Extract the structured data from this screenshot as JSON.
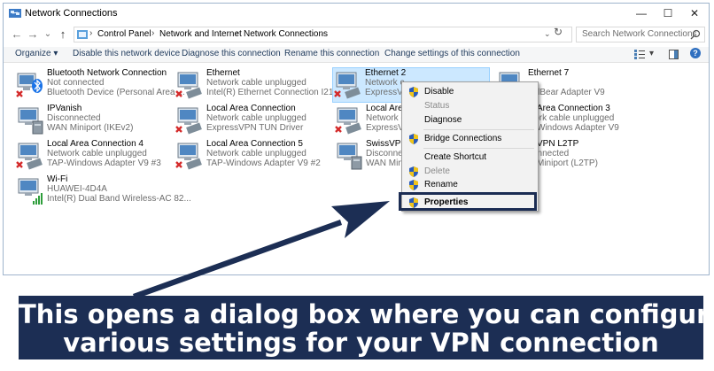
{
  "window": {
    "title": "Network Connections",
    "controls": {
      "minimize": "—",
      "maximize": "☐",
      "close": "✕"
    }
  },
  "address_bar": {
    "back_icon": "←",
    "forward_icon": "→",
    "recent_icon": "⌄",
    "up_icon": "↑",
    "breadcrumb": [
      "Control Panel",
      "Network and Internet",
      "Network Connections"
    ],
    "separator": "›",
    "dropdown_icon": "⌄",
    "refresh_icon": "↻",
    "search_placeholder": "Search Network Connections"
  },
  "toolbar": {
    "organize": "Organize ▾",
    "disable_device": "Disable this network device",
    "diagnose": "Diagnose this connection",
    "rename": "Rename this connection",
    "change_settings": "Change settings of this connection",
    "view_menu": "▾",
    "help": "?"
  },
  "connections": [
    {
      "name": "Bluetooth Network Connection",
      "status": "Not connected",
      "device": "Bluetooth Device (Personal Area ..."
    },
    {
      "name": "Ethernet",
      "status": "Network cable unplugged",
      "device": "Intel(R) Ethernet Connection I219..."
    },
    {
      "name": "Ethernet 2",
      "status": "Network c",
      "device": "ExpressVPN"
    },
    {
      "name": "Ethernet 7",
      "status": "",
      "device": "nelBear Adapter V9"
    },
    {
      "name": "IPVanish",
      "status": "Disconnected",
      "device": "WAN Miniport (IKEv2)"
    },
    {
      "name": "Local Area Connection",
      "status": "Network cable unplugged",
      "device": "ExpressVPN TUN Driver"
    },
    {
      "name": "Local Are",
      "status": "Network c",
      "device": "ExpressVP"
    },
    {
      "name": "al Area Connection 3",
      "status": "work cable unplugged",
      "device": "P-Windows Adapter V9"
    },
    {
      "name": "Local Area Connection 4",
      "status": "Network cable unplugged",
      "device": "TAP-Windows Adapter V9 #3"
    },
    {
      "name": "Local Area Connection 5",
      "status": "Network cable unplugged",
      "device": "TAP-Windows Adapter V9 #2"
    },
    {
      "name": "SwissVPN",
      "status": "Disconnec",
      "device": "WAN Minip"
    },
    {
      "name": "ssVPN L2TP",
      "status": "connected",
      "device": "N Miniport (L2TP)"
    },
    {
      "name": "Wi-Fi",
      "status": "HUAWEI-4D4A",
      "device": "Intel(R) Dual Band Wireless-AC 82..."
    }
  ],
  "context_menu": {
    "items": [
      {
        "label": "Disable",
        "shield": true,
        "disabled": false
      },
      {
        "label": "Status",
        "shield": false,
        "disabled": true
      },
      {
        "label": "Diagnose",
        "shield": false,
        "disabled": false
      },
      {
        "label": "Bridge Connections",
        "shield": true,
        "disabled": false
      },
      {
        "label": "Create Shortcut",
        "shield": false,
        "disabled": false
      },
      {
        "label": "Delete",
        "shield": true,
        "disabled": true
      },
      {
        "label": "Rename",
        "shield": true,
        "disabled": false
      },
      {
        "label": "Properties",
        "shield": true,
        "disabled": false,
        "bold": true
      }
    ]
  },
  "caption": {
    "line1": "This opens a dialog box where you can configure",
    "line2": "various settings for your VPN connection"
  },
  "colors": {
    "banner": "#1c2e54",
    "selection": "#cce8ff",
    "link_text": "#1e395b",
    "error_x": "#d42b2b",
    "shield_blue": "#2a5bb8",
    "shield_yellow": "#f0c419"
  }
}
